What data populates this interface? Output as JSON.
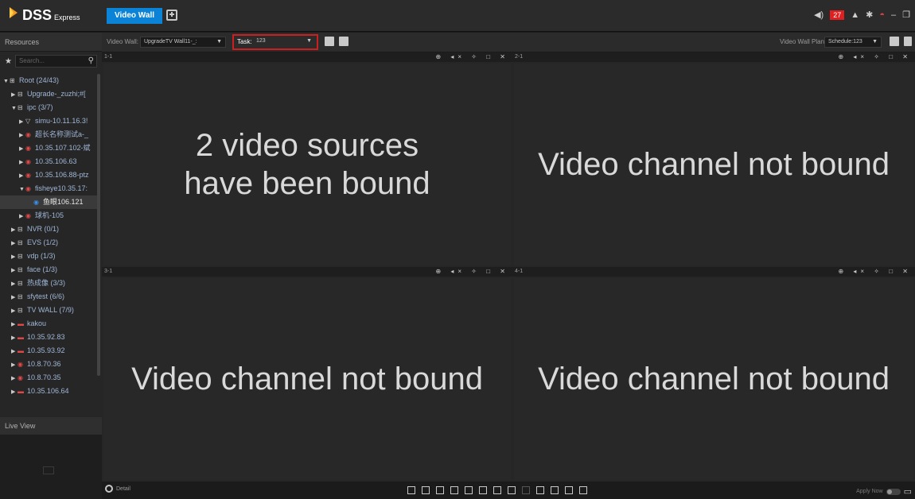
{
  "app": {
    "name": "DSS",
    "edition": "Express"
  },
  "tabs": [
    {
      "label": "Video Wall",
      "active": true
    }
  ],
  "header_right": {
    "alarm_count": "27"
  },
  "left_panel": {
    "title": "Resources",
    "search_placeholder": "Search...",
    "tree": [
      {
        "label": "Root (24/43)",
        "level": 0,
        "expanded": true,
        "icon": "folder-icon"
      },
      {
        "label": "Upgrade-_zuzhi;#[",
        "level": 1,
        "expanded": false,
        "icon": "org-icon"
      },
      {
        "label": "ipc (3/7)",
        "level": 1,
        "expanded": true,
        "icon": "org-icon"
      },
      {
        "label": "simu-10.11.16.3!",
        "level": 2,
        "expanded": false,
        "icon": "nvr-icon"
      },
      {
        "label": "超长名称测试a-_",
        "level": 2,
        "expanded": false,
        "icon": "camera-red-icon"
      },
      {
        "label": "10.35.107.102-斌",
        "level": 2,
        "expanded": false,
        "icon": "camera-red-icon"
      },
      {
        "label": "10.35.106.63",
        "level": 2,
        "expanded": false,
        "icon": "camera-red-icon"
      },
      {
        "label": "10.35.106.88-ptz",
        "level": 2,
        "expanded": false,
        "icon": "camera-red-icon"
      },
      {
        "label": "fisheye10.35.17:",
        "level": 2,
        "expanded": true,
        "icon": "camera-red-icon"
      },
      {
        "label": "鱼眼106.121",
        "level": 3,
        "selected": true,
        "icon": "fisheye-icon"
      },
      {
        "label": "球机-105",
        "level": 2,
        "expanded": false,
        "icon": "camera-red-icon"
      },
      {
        "label": "NVR (0/1)",
        "level": 1,
        "expanded": false,
        "icon": "org-icon"
      },
      {
        "label": "EVS (1/2)",
        "level": 1,
        "expanded": false,
        "icon": "org-icon"
      },
      {
        "label": "vdp (1/3)",
        "level": 1,
        "expanded": false,
        "icon": "org-icon"
      },
      {
        "label": "face (1/3)",
        "level": 1,
        "expanded": false,
        "icon": "org-icon"
      },
      {
        "label": "热成像 (3/3)",
        "level": 1,
        "expanded": false,
        "icon": "org-icon"
      },
      {
        "label": "sfytest (6/6)",
        "level": 1,
        "expanded": false,
        "icon": "org-icon"
      },
      {
        "label": "TV WALL (7/9)",
        "level": 1,
        "expanded": false,
        "icon": "org-icon"
      },
      {
        "label": "kakou",
        "level": 1,
        "expanded": false,
        "icon": "device-red-icon"
      },
      {
        "label": "10.35.92.83",
        "level": 1,
        "expanded": false,
        "icon": "device-red-icon"
      },
      {
        "label": "10.35.93.92",
        "level": 1,
        "expanded": false,
        "icon": "device-red-icon"
      },
      {
        "label": "10.8.70.36",
        "level": 1,
        "expanded": false,
        "icon": "camera-red-icon"
      },
      {
        "label": "10.8.70.35",
        "level": 1,
        "expanded": false,
        "icon": "camera-red-icon"
      },
      {
        "label": "10.35.106.64",
        "level": 1,
        "expanded": false,
        "icon": "device-red-icon"
      }
    ],
    "live_view_title": "Live View"
  },
  "toolbar": {
    "video_wall_label": "Video Wall:",
    "video_wall_value": "UpgradeTV Wall11-_:",
    "task_label": "Task:",
    "task_value": "123",
    "plan_label": "Video Wall Plan:",
    "plan_value": "Schedule:123"
  },
  "windows": [
    {
      "id": "1-1",
      "text": "2 video sources have been bound"
    },
    {
      "id": "2-1",
      "text": "Video channel not bound"
    },
    {
      "id": "3-1",
      "text": "Video channel not bound"
    },
    {
      "id": "4-1",
      "text": "Video channel not bound"
    }
  ],
  "bottom": {
    "detail_label": "Detail",
    "apply_now_label": "Apply Now"
  }
}
